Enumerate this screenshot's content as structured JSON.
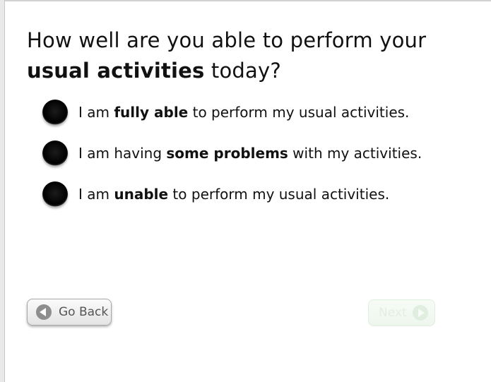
{
  "question": {
    "line1": "How well are you able to perform your",
    "emphasis": "usual activities",
    "tail": " today?"
  },
  "options": [
    {
      "pre": "I am ",
      "bold": "fully able",
      "post": " to perform my usual activities."
    },
    {
      "pre": "I am having ",
      "bold": "some problems",
      "post": " with my activities."
    },
    {
      "pre": "I am ",
      "bold": "unable",
      "post": " to perform my usual activities."
    }
  ],
  "buttons": {
    "back_label": "Go Back",
    "next_label": "Next"
  },
  "icons": {
    "back": "arrow-left-circle-icon",
    "next": "arrow-right-circle-icon"
  },
  "colors": {
    "next_disabled": "#e2efe2",
    "radio": "#000000"
  }
}
